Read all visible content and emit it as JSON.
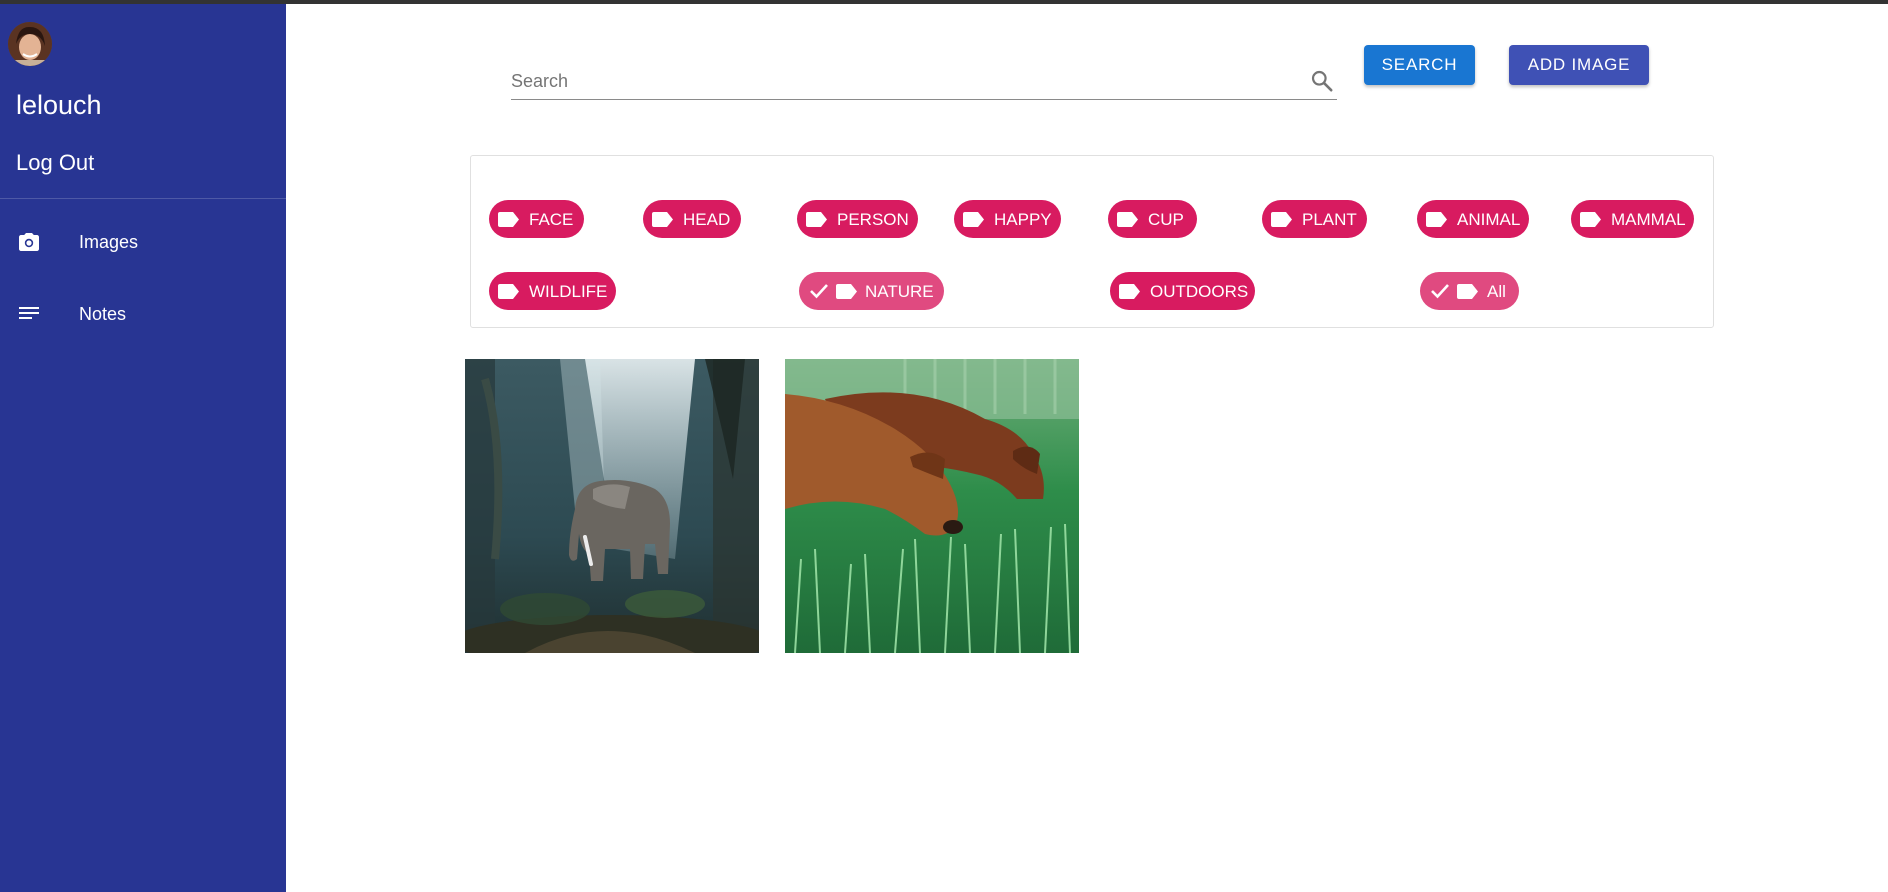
{
  "user": {
    "name": "lelouch",
    "logout_label": "Log Out"
  },
  "sidebar": {
    "items": [
      {
        "label": "Images",
        "icon": "camera-icon"
      },
      {
        "label": "Notes",
        "icon": "notes-icon"
      }
    ]
  },
  "search": {
    "placeholder": "Search",
    "value": "",
    "button_label": "SEARCH"
  },
  "add_image_label": "ADD IMAGE",
  "tags": [
    {
      "label": "FACE",
      "selected": false
    },
    {
      "label": "HEAD",
      "selected": false
    },
    {
      "label": "PERSON",
      "selected": false
    },
    {
      "label": "HAPPY",
      "selected": false
    },
    {
      "label": "CUP",
      "selected": false
    },
    {
      "label": "PLANT",
      "selected": false
    },
    {
      "label": "ANIMAL",
      "selected": false
    },
    {
      "label": "MAMMAL",
      "selected": false
    },
    {
      "label": "WILDLIFE",
      "selected": false
    },
    {
      "label": "NATURE",
      "selected": true
    },
    {
      "label": "OUTDOORS",
      "selected": false
    },
    {
      "label": "All",
      "selected": true
    }
  ],
  "images": [
    {
      "subject": "elephant in forest"
    },
    {
      "subject": "dogs in grass"
    }
  ],
  "colors": {
    "sidebar": "#283593",
    "chip": "#d81b60",
    "search_button": "#1976d2",
    "add_button": "#3f51b5"
  }
}
